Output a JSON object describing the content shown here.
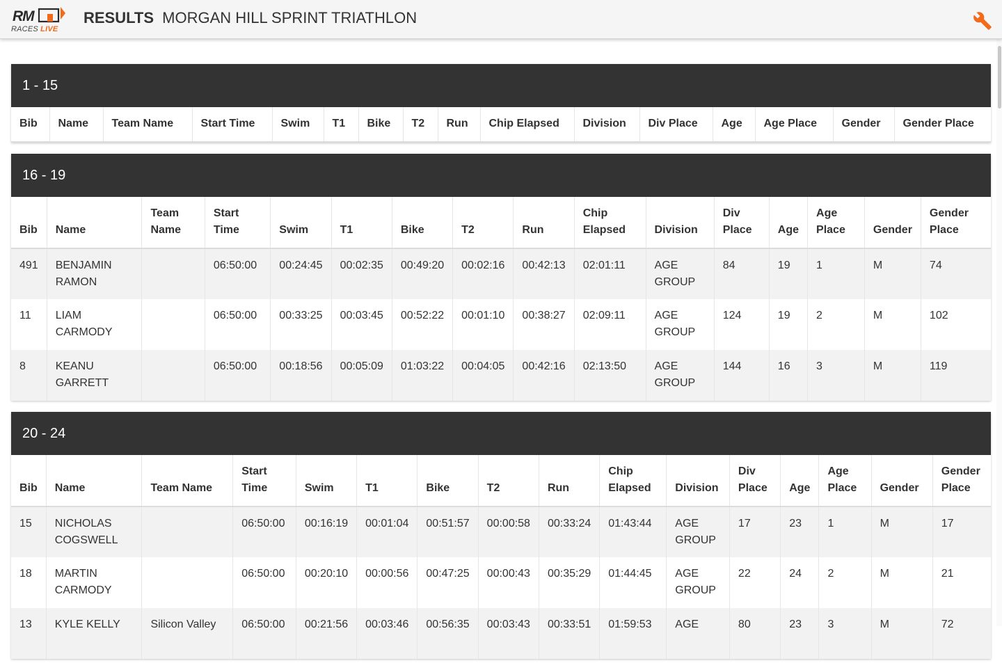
{
  "header": {
    "logo_text": "RM",
    "logo_races": "RACES",
    "logo_live": "LIVE",
    "title_bold": "RESULTS",
    "title_event": "MORGAN HILL SPRINT TRIATHLON",
    "settings_icon": "wrench-icon",
    "accent_color": "#f26a1b"
  },
  "columns": [
    "Bib",
    "Name",
    "Team Name",
    "Start Time",
    "Swim",
    "T1",
    "Bike",
    "T2",
    "Run",
    "Chip Elapsed",
    "Division",
    "Div Place",
    "Age",
    "Age Place",
    "Gender",
    "Gender Place"
  ],
  "sections": [
    {
      "title": "1 - 15",
      "rows": []
    },
    {
      "title": "16 - 19",
      "rows": [
        [
          "491",
          "BENJAMIN RAMON",
          "",
          "06:50:00",
          "00:24:45",
          "00:02:35",
          "00:49:20",
          "00:02:16",
          "00:42:13",
          "02:01:11",
          "AGE GROUP",
          "84",
          "19",
          "1",
          "M",
          "74"
        ],
        [
          "11",
          "LIAM CARMODY",
          "",
          "06:50:00",
          "00:33:25",
          "00:03:45",
          "00:52:22",
          "00:01:10",
          "00:38:27",
          "02:09:11",
          "AGE GROUP",
          "124",
          "19",
          "2",
          "M",
          "102"
        ],
        [
          "8",
          "KEANU GARRETT",
          "",
          "06:50:00",
          "00:18:56",
          "00:05:09",
          "01:03:22",
          "00:04:05",
          "00:42:16",
          "02:13:50",
          "AGE GROUP",
          "144",
          "16",
          "3",
          "M",
          "119"
        ]
      ]
    },
    {
      "title": "20 - 24",
      "rows": [
        [
          "15",
          "NICHOLAS COGSWELL",
          "",
          "06:50:00",
          "00:16:19",
          "00:01:04",
          "00:51:57",
          "00:00:58",
          "00:33:24",
          "01:43:44",
          "AGE GROUP",
          "17",
          "23",
          "1",
          "M",
          "17"
        ],
        [
          "18",
          "MARTIN CARMODY",
          "",
          "06:50:00",
          "00:20:10",
          "00:00:56",
          "00:47:25",
          "00:00:43",
          "00:35:29",
          "01:44:45",
          "AGE GROUP",
          "22",
          "24",
          "2",
          "M",
          "21"
        ],
        [
          "13",
          "KYLE KELLY",
          "Silicon Valley",
          "06:50:00",
          "00:21:56",
          "00:03:46",
          "00:56:35",
          "00:03:43",
          "00:33:51",
          "01:59:53",
          "AGE",
          "80",
          "23",
          "3",
          "M",
          "72"
        ]
      ]
    }
  ]
}
